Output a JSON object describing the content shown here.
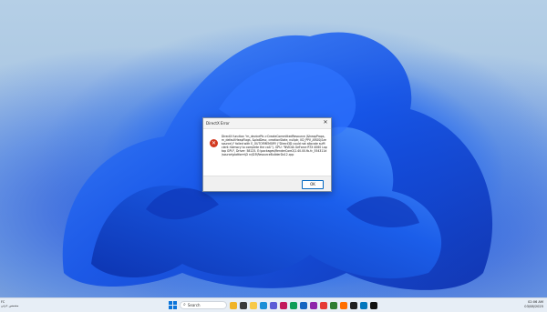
{
  "desktop": {
    "wallpaper": "windows-11-bloom"
  },
  "dialog": {
    "title": "DirectX Error",
    "close_label": "✕",
    "icon": "error-icon",
    "message": "DirectX function \"m_devicePtr->CreateCommittedResource (&heapProps, m_defaultHeapFlags, &platDesc, creationState, nullptr, IID_PPV_ARGS(&resource))\" failed with E_OUTOFMEMORY (\"Direct3D could not allocate sufficient memory to complete the call.\"). GPU: \"NVIDIA GeForce RTX 4060 Laptop GPU\", Driver: 58125. E:\\packages\\RenderCore2\\2.40.00.fb-fc_554311d\\source\\platform\\D rv\\D3\\ResourceBuilderDx12.cpp",
    "ok_label": "OK"
  },
  "taskbar": {
    "left_weather": {
      "temp": "FC",
      "condition": "مشمس جزئي"
    },
    "search_placeholder": "Search",
    "apps": [
      {
        "name": "widgets-icon",
        "color": "#f0b429"
      },
      {
        "name": "task-view-icon",
        "color": "#3a3a3a"
      },
      {
        "name": "file-explorer-icon",
        "color": "#f7c948"
      },
      {
        "name": "edge-icon",
        "color": "#1b8fd6"
      },
      {
        "name": "store-icon",
        "color": "#5a5ad6"
      },
      {
        "name": "app-icon-1",
        "color": "#c2185b"
      },
      {
        "name": "app-icon-2",
        "color": "#0f9d58"
      },
      {
        "name": "app-icon-3",
        "color": "#1565c0"
      },
      {
        "name": "app-icon-4",
        "color": "#8e24aa"
      },
      {
        "name": "app-icon-5",
        "color": "#e53935"
      },
      {
        "name": "app-icon-6",
        "color": "#2e7d32"
      },
      {
        "name": "app-icon-7",
        "color": "#ff6f00"
      },
      {
        "name": "app-icon-8",
        "color": "#202020"
      },
      {
        "name": "app-icon-9",
        "color": "#0277bd"
      },
      {
        "name": "app-icon-10",
        "color": "#111111"
      }
    ],
    "clock": {
      "time": "02:06 AM",
      "date": "03/08/2025"
    }
  }
}
